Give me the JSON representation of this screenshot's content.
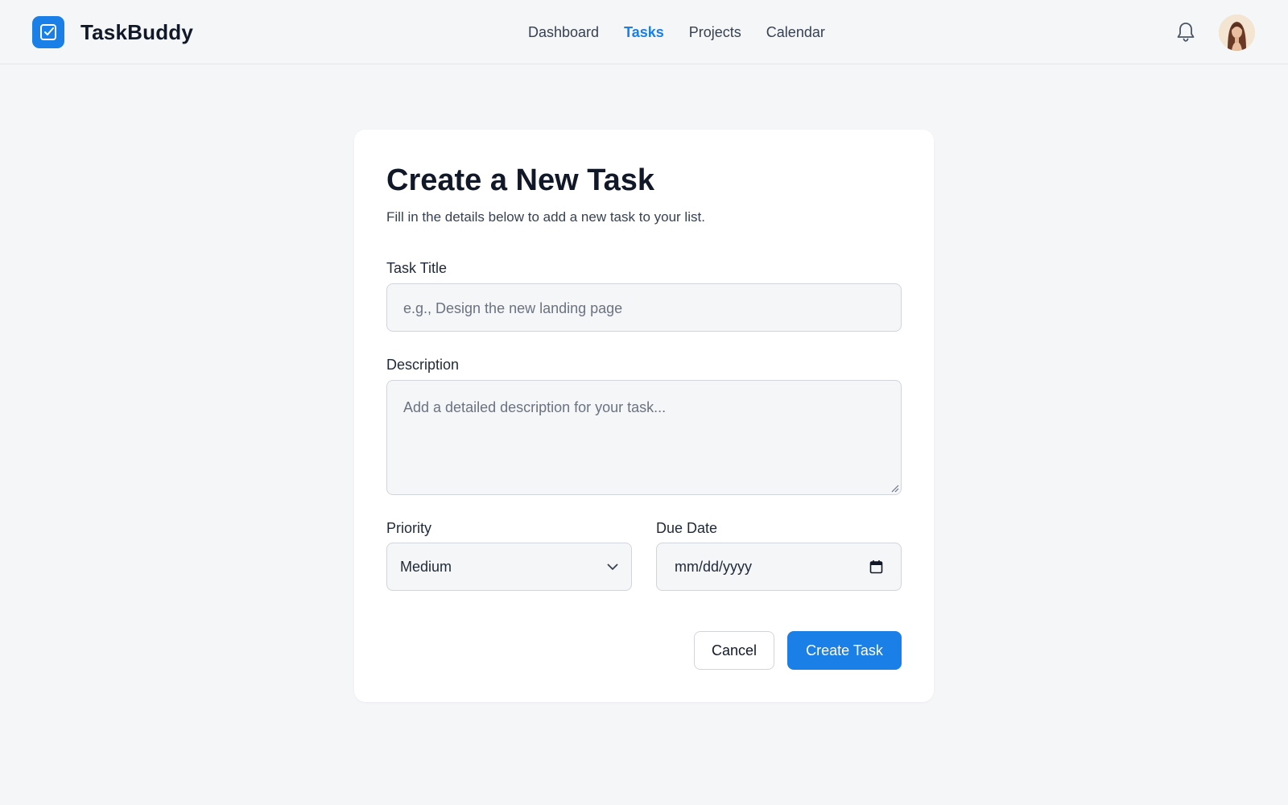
{
  "app": {
    "name": "TaskBuddy",
    "logo_icon": "checkbox-check-icon",
    "accent_color": "#1a7fe6"
  },
  "nav": {
    "items": [
      {
        "label": "Dashboard",
        "active": false
      },
      {
        "label": "Tasks",
        "active": true
      },
      {
        "label": "Projects",
        "active": false
      },
      {
        "label": "Calendar",
        "active": false
      }
    ]
  },
  "header": {
    "notification_icon": "bell-icon",
    "avatar": "user-avatar"
  },
  "form": {
    "title": "Create a New Task",
    "subtitle": "Fill in the details below to add a new task to your list.",
    "task_title": {
      "label": "Task Title",
      "value": "",
      "placeholder": "e.g., Design the new landing page"
    },
    "description": {
      "label": "Description",
      "value": "",
      "placeholder": "Add a detailed description for your task..."
    },
    "priority": {
      "label": "Priority",
      "selected": "Medium"
    },
    "due_date": {
      "label": "Due Date",
      "value": "mm/dd/yyyy"
    },
    "actions": {
      "cancel_label": "Cancel",
      "submit_label": "Create Task"
    }
  }
}
